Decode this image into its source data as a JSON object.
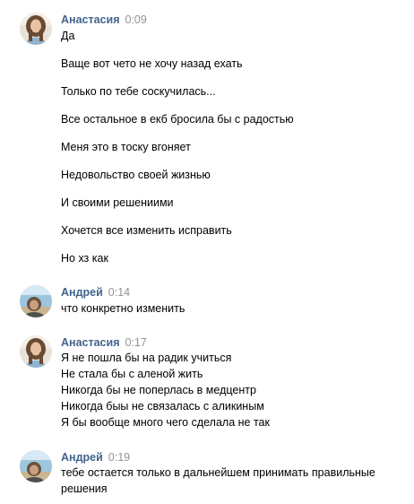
{
  "messages": [
    {
      "author": "Анастасия",
      "time": "0:09",
      "avatar": "girl-photo",
      "lines": [
        "Да",
        "Ваще вот чето не хочу назад ехать",
        "Только по тебе соскучилась...",
        "Все остальное в екб бросила бы с радостью",
        "Меня это в тоску вгоняет",
        "Недовольство своей жизнью",
        "И своими решениими",
        "Хочется все изменить исправить",
        "Но хз как"
      ]
    },
    {
      "author": "Андрей",
      "time": "0:14",
      "avatar": "beach-photo",
      "lines": [
        "что конкретно изменить"
      ]
    },
    {
      "author": "Анастасия",
      "time": "0:17",
      "avatar": "girl-photo",
      "lines": [
        "Я не пошла бы на радик учиться",
        "Не стала бы с аленой жить",
        "Никогда бы не поперлась в медцентр",
        "Никогда быы не связалась с аликиным",
        "Я бы вообще много чего сделала не так"
      ]
    },
    {
      "author": "Андрей",
      "time": "0:19",
      "avatar": "beach-photo",
      "lines": [
        "тебе остается только в дальнейшем принимать правильные",
        "решения"
      ]
    }
  ],
  "colors": {
    "author": "#42648b",
    "time": "#939393",
    "text": "#000000"
  }
}
